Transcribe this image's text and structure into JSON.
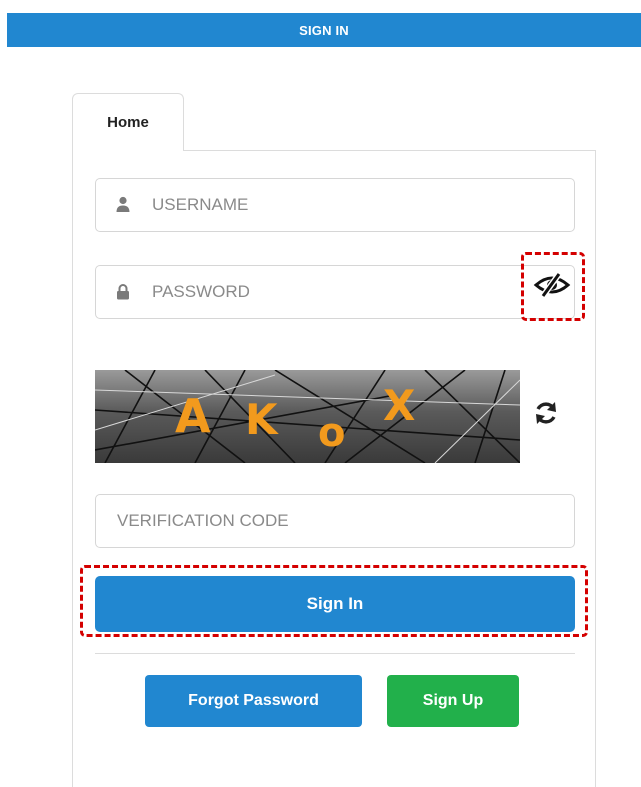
{
  "header": {
    "title": "SIGN IN"
  },
  "tabs": [
    {
      "label": "Home"
    }
  ],
  "form": {
    "username": {
      "placeholder": "USERNAME",
      "value": ""
    },
    "password": {
      "placeholder": "PASSWORD",
      "value": ""
    },
    "captcha": {
      "text": "AKoX"
    },
    "verification": {
      "placeholder": "VERIFICATION CODE",
      "value": ""
    },
    "sign_in_label": "Sign In",
    "forgot_password_label": "Forgot Password",
    "sign_up_label": "Sign Up"
  },
  "icons": {
    "username": "user-icon",
    "password": "lock-icon",
    "toggle_visibility": "eye-slash-icon",
    "refresh": "refresh-icon"
  },
  "colors": {
    "primary": "#2187d0",
    "success": "#22b04b",
    "highlight": "#d40000"
  }
}
